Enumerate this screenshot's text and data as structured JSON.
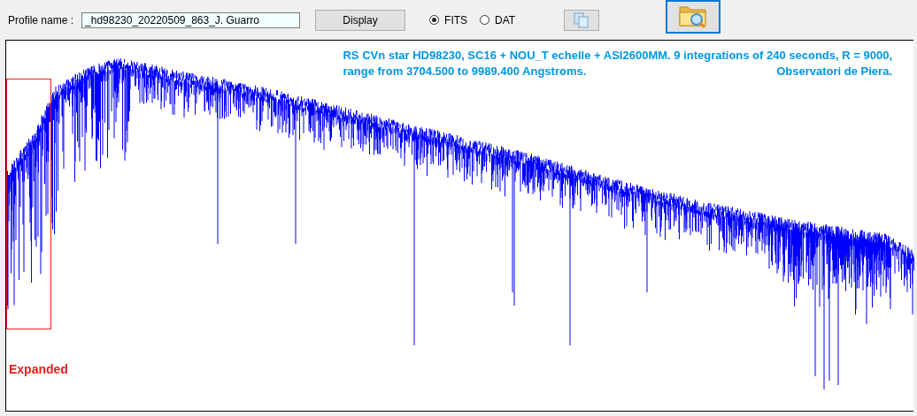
{
  "toolbar": {
    "profile_label": "Profile name :",
    "profile_value": "_hd98230_20220509_863_J. Guarro",
    "display_button": "Display",
    "formats": [
      {
        "label": "FITS",
        "selected": true
      },
      {
        "label": "DAT",
        "selected": false
      }
    ]
  },
  "plot": {
    "title_line_1": "RS CVn star HD98230, SC16 + NOU_T echelle + ASI2600MM. 9 integrations of 240 seconds, R = 9000,",
    "title_line_2": "range from 3704.500 to 9989.400 Angstroms.",
    "credit": "Observatori de Piera.",
    "marker_label": "Expanded"
  }
}
